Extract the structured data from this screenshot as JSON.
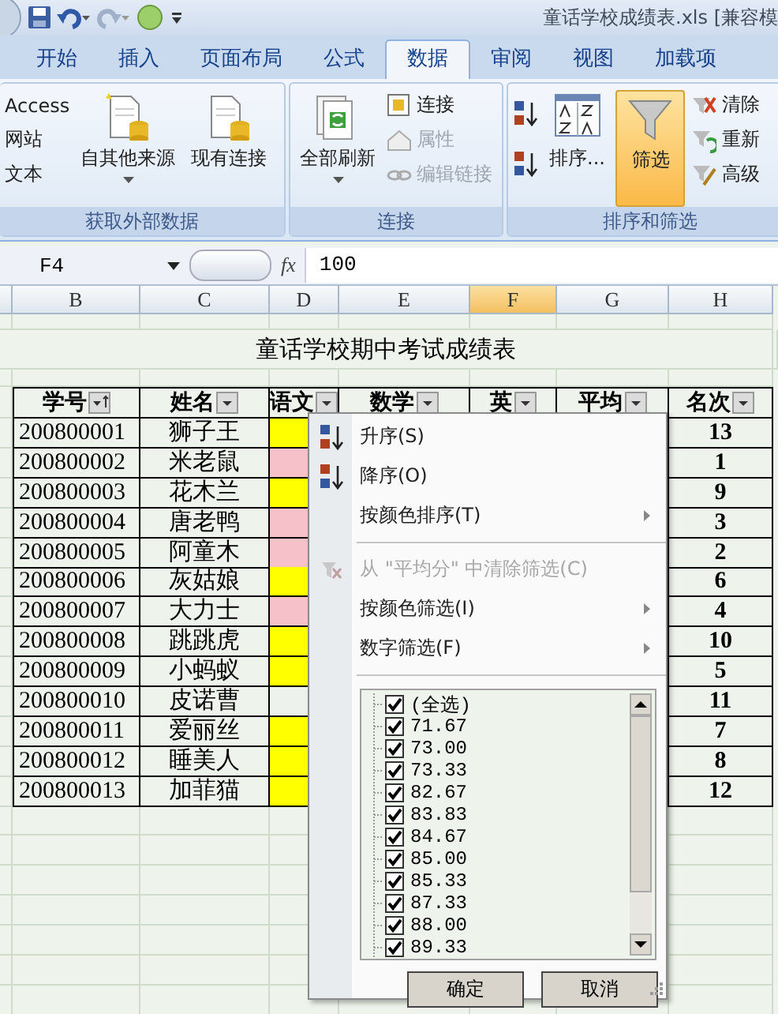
{
  "window": {
    "title": "童话学校成绩表.xls  [兼容模"
  },
  "tabs": [
    {
      "label": "开始",
      "selected": false
    },
    {
      "label": "插入",
      "selected": false
    },
    {
      "label": "页面布局",
      "selected": false
    },
    {
      "label": "公式",
      "selected": false
    },
    {
      "label": "数据",
      "selected": true
    },
    {
      "label": "审阅",
      "selected": false
    },
    {
      "label": "视图",
      "selected": false
    },
    {
      "label": "加载项",
      "selected": false
    }
  ],
  "ribbon": {
    "groups": [
      {
        "label": "获取外部数据",
        "items": [
          {
            "kind": "stack",
            "entries": [
              {
                "label": "Access",
                "disabled": false
              },
              {
                "label": "网站",
                "disabled": false
              },
              {
                "label": "文本",
                "disabled": false
              }
            ]
          },
          {
            "kind": "large",
            "label": "自其他来源",
            "caret": true,
            "selected": false
          },
          {
            "kind": "large",
            "label": "现有连接",
            "caret": false,
            "selected": false
          }
        ]
      },
      {
        "label": "连接",
        "items": [
          {
            "kind": "large",
            "label": "全部刷新",
            "caret": true,
            "selected": false
          },
          {
            "kind": "stack",
            "entries": [
              {
                "label": "连接",
                "disabled": false
              },
              {
                "label": "属性",
                "disabled": true
              },
              {
                "label": "编辑链接",
                "disabled": true
              }
            ]
          }
        ]
      },
      {
        "label": "排序和筛选",
        "items": [
          {
            "kind": "icons"
          },
          {
            "kind": "large",
            "label": "排序...",
            "caret": false,
            "selected": false
          },
          {
            "kind": "large",
            "label": "筛选",
            "caret": false,
            "selected": true
          },
          {
            "kind": "stack",
            "entries": [
              {
                "label": "清除",
                "disabled": false
              },
              {
                "label": "重新",
                "disabled": false
              },
              {
                "label": "高级",
                "disabled": false
              }
            ]
          }
        ]
      }
    ]
  },
  "formula_bar": {
    "name_box": "F4",
    "fx": "fx",
    "value": "100"
  },
  "sheet": {
    "columns": [
      {
        "label": "B",
        "selected": false
      },
      {
        "label": "C",
        "selected": false
      },
      {
        "label": "D",
        "selected": false
      },
      {
        "label": "E",
        "selected": false
      },
      {
        "label": "F",
        "selected": true
      },
      {
        "label": "G",
        "selected": false
      },
      {
        "label": "H",
        "selected": false
      }
    ],
    "title": "童话学校期中考试成绩表",
    "headers": [
      {
        "label": "学号",
        "sorted": true
      },
      {
        "label": "姓名",
        "sorted": false
      },
      {
        "label": "语文",
        "sorted": false
      },
      {
        "label": "数学",
        "sorted": false
      },
      {
        "label": "英",
        "sorted": false
      },
      {
        "label": "平均",
        "sorted": false
      },
      {
        "label": "名次",
        "sorted": false
      }
    ],
    "rows": [
      {
        "id": "200800001",
        "name": "狮子王",
        "color": "#ffff00",
        "rank": "13"
      },
      {
        "id": "200800002",
        "name": "米老鼠",
        "color": "#f6c1c8",
        "rank": "1"
      },
      {
        "id": "200800003",
        "name": "花木兰",
        "color": "#ffff00",
        "rank": "9"
      },
      {
        "id": "200800004",
        "name": "唐老鸭",
        "color": "#f6c1c8",
        "rank": "3"
      },
      {
        "id": "200800005",
        "name": "阿童木",
        "color": "#f6c1c8",
        "rank": "2"
      },
      {
        "id": "200800006",
        "name": "灰姑娘",
        "color": "#ffff00",
        "rank": "6"
      },
      {
        "id": "200800007",
        "name": "大力士",
        "color": "#f6c1c8",
        "rank": "4"
      },
      {
        "id": "200800008",
        "name": "跳跳虎",
        "color": "#ffff00",
        "rank": "10"
      },
      {
        "id": "200800009",
        "name": "小蚂蚁",
        "color": "#ffff00",
        "rank": "5"
      },
      {
        "id": "200800010",
        "name": "皮诺曹",
        "color": "#eef2ec",
        "rank": "11"
      },
      {
        "id": "200800011",
        "name": "爱丽丝",
        "color": "#ffff00",
        "rank": "7"
      },
      {
        "id": "200800012",
        "name": "睡美人",
        "color": "#ffff00",
        "rank": "8"
      },
      {
        "id": "200800013",
        "name": "加菲猫",
        "color": "#ffff00",
        "rank": "12"
      }
    ]
  },
  "filter_menu": {
    "items": [
      {
        "kind": "sort-asc",
        "label": "升序(S)",
        "disabled": false,
        "submenu": false
      },
      {
        "kind": "sort-desc",
        "label": "降序(O)",
        "disabled": false,
        "submenu": false
      },
      {
        "kind": "plain",
        "label": "按颜色排序(T)",
        "disabled": false,
        "submenu": true
      },
      {
        "kind": "separator"
      },
      {
        "kind": "clear",
        "label": "从 \"平均分\" 中清除筛选(C)",
        "disabled": true,
        "submenu": false
      },
      {
        "kind": "plain",
        "label": "按颜色筛选(I)",
        "disabled": false,
        "submenu": true
      },
      {
        "kind": "plain",
        "label": "数字筛选(F)",
        "disabled": false,
        "submenu": true
      },
      {
        "kind": "separator"
      }
    ],
    "values": [
      {
        "label": "(全选)",
        "checked": true
      },
      {
        "label": "71.67",
        "checked": true
      },
      {
        "label": "73.00",
        "checked": true
      },
      {
        "label": "73.33",
        "checked": true
      },
      {
        "label": "82.67",
        "checked": true
      },
      {
        "label": "83.83",
        "checked": true
      },
      {
        "label": "84.67",
        "checked": true
      },
      {
        "label": "85.00",
        "checked": true
      },
      {
        "label": "85.33",
        "checked": true
      },
      {
        "label": "87.33",
        "checked": true
      },
      {
        "label": "88.00",
        "checked": true
      },
      {
        "label": "89.33",
        "checked": true
      }
    ],
    "buttons": [
      "确定",
      "取消"
    ]
  }
}
